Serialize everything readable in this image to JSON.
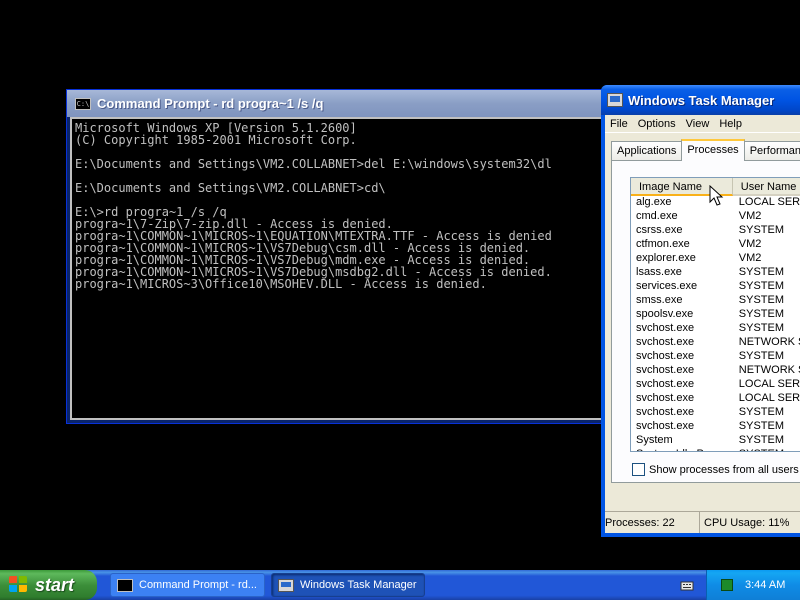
{
  "cmd_window": {
    "title": "Command Prompt - rd progra~1 /s /q",
    "lines": [
      "Microsoft Windows XP [Version 5.1.2600]",
      "(C) Copyright 1985-2001 Microsoft Corp.",
      "",
      "E:\\Documents and Settings\\VM2.COLLABNET>del E:\\windows\\system32\\dl",
      "",
      "E:\\Documents and Settings\\VM2.COLLABNET>cd\\",
      "",
      "E:\\>rd progra~1 /s /q",
      "progra~1\\7-Zip\\7-zip.dll - Access is denied.",
      "progra~1\\COMMON~1\\MICROS~1\\EQUATION\\MTEXTRA.TTF - Access is denied",
      "progra~1\\COMMON~1\\MICROS~1\\VS7Debug\\csm.dll - Access is denied.",
      "progra~1\\COMMON~1\\MICROS~1\\VS7Debug\\mdm.exe - Access is denied.",
      "progra~1\\COMMON~1\\MICROS~1\\VS7Debug\\msdbg2.dll - Access is denied.",
      "progra~1\\MICROS~3\\Office10\\MSOHEV.DLL - Access is denied."
    ]
  },
  "task_manager": {
    "title": "Windows Task Manager",
    "menu": [
      "File",
      "Options",
      "View",
      "Help"
    ],
    "tabs": [
      "Applications",
      "Processes",
      "Performance"
    ],
    "active_tab": "Processes",
    "columns": [
      "Image Name",
      "User Name"
    ],
    "processes": [
      {
        "name": "alg.exe",
        "user": "LOCAL SERVICE"
      },
      {
        "name": "cmd.exe",
        "user": "VM2"
      },
      {
        "name": "csrss.exe",
        "user": "SYSTEM"
      },
      {
        "name": "ctfmon.exe",
        "user": "VM2"
      },
      {
        "name": "explorer.exe",
        "user": "VM2"
      },
      {
        "name": "lsass.exe",
        "user": "SYSTEM"
      },
      {
        "name": "services.exe",
        "user": "SYSTEM"
      },
      {
        "name": "smss.exe",
        "user": "SYSTEM"
      },
      {
        "name": "spoolsv.exe",
        "user": "SYSTEM"
      },
      {
        "name": "svchost.exe",
        "user": "SYSTEM"
      },
      {
        "name": "svchost.exe",
        "user": "NETWORK SERVICE"
      },
      {
        "name": "svchost.exe",
        "user": "SYSTEM"
      },
      {
        "name": "svchost.exe",
        "user": "NETWORK SERVICE"
      },
      {
        "name": "svchost.exe",
        "user": "LOCAL SERVICE"
      },
      {
        "name": "svchost.exe",
        "user": "LOCAL SERVICE"
      },
      {
        "name": "svchost.exe",
        "user": "SYSTEM"
      },
      {
        "name": "svchost.exe",
        "user": "SYSTEM"
      },
      {
        "name": "System",
        "user": "SYSTEM"
      },
      {
        "name": "System Idle Process",
        "user": "SYSTEM"
      }
    ],
    "show_all_label": "Show processes from all users",
    "show_all_checked": false,
    "status_processes": "Processes: 22",
    "status_cpu": "CPU Usage: 11%"
  },
  "taskbar": {
    "start_label": "start",
    "buttons": [
      {
        "label": "Command Prompt - rd...",
        "icon": "cmd-icon"
      },
      {
        "label": "Windows Task Manager",
        "icon": "task-manager-icon"
      }
    ],
    "clock": "3:44 AM"
  }
}
